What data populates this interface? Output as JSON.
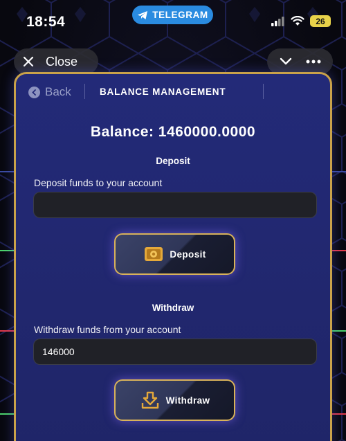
{
  "status_bar": {
    "time": "18:54",
    "app_pill": "TELEGRAM",
    "battery": "26"
  },
  "top_controls": {
    "close_label": "Close"
  },
  "panel": {
    "back_label": "Back",
    "title": "BALANCE MANAGEMENT",
    "balance": "Balance: 1460000.0000",
    "deposit": {
      "section_title": "Deposit",
      "field_label": "Deposit funds to your account",
      "value": "",
      "button_label": "Deposit"
    },
    "withdraw": {
      "section_title": "Withdraw",
      "field_label": "Withdraw funds from your account",
      "value": "146000",
      "button_label": "Withdraw"
    }
  },
  "colors": {
    "accent_gold": "#c9a24a",
    "panel_blue": "#232a78",
    "telegram_blue": "#2a8be0"
  }
}
